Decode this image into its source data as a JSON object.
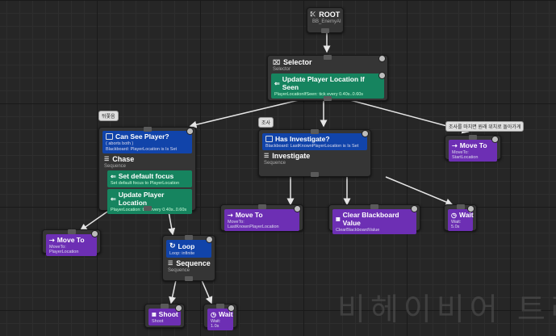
{
  "colors": {
    "background": "#262626",
    "composite": "#353535",
    "decorator": "#1144aa",
    "service": "#16845f",
    "task": "#6d2fb4",
    "wire": "#e6e6e6"
  },
  "root": {
    "title": "ROOT",
    "sub": "BB_EnemyAI",
    "icon": "root-icon"
  },
  "selector": {
    "title": "Selector",
    "sub": "Selector",
    "icon": "selector-icon",
    "service": {
      "title": "Update Player Location If Seen",
      "sub": "PlayerLocationIfSeen: tick every 0.40s..0.60s"
    }
  },
  "chase": {
    "comment": "뒤쫓음",
    "decorator": {
      "title": "Can See Player?",
      "line1": "( aborts both )",
      "line2": "Blackboard: PlayerLocation is Is Set"
    },
    "title": "Chase",
    "sub": "Sequence",
    "service1": {
      "title": "Set default focus",
      "sub": "Set default focus to PlayerLocation"
    },
    "service2": {
      "title": "Update Player Location",
      "sub": "PlayerLocation: tick every 0.40s..0.60s"
    }
  },
  "investigate": {
    "comment": "조사",
    "decorator": {
      "title": "Has Investigate?",
      "sub": "Blackboard: LastKnownPlayerLocation is Is Set"
    },
    "title": "Investigate",
    "sub": "Sequence"
  },
  "task_moveto_player": {
    "title": "Move To",
    "sub": "MoveTo: PlayerLocation"
  },
  "loop_node": {
    "decorator": {
      "title": "Loop",
      "sub": "Loop: infinite"
    },
    "title": "Sequence",
    "sub": "Sequence"
  },
  "task_shoot": {
    "title": "Shoot",
    "sub": "Shoot"
  },
  "task_wait_1": {
    "title": "Wait",
    "sub": "Wait: 1.0s"
  },
  "task_moveto_last": {
    "title": "Move To",
    "sub": "MoveTo: LastKnownPlayerLocation"
  },
  "task_clear_bb": {
    "title": "Clear Blackboard Value",
    "sub": "ClearBlackboardValue"
  },
  "task_wait_5": {
    "title": "Wait",
    "sub": "Wait: 5.0s"
  },
  "return": {
    "comment": "조사를 마치면 원래 위치로 돌아가게",
    "title": "Move To",
    "sub": "MoveTo: StartLocation"
  },
  "watermark": "비헤이비어 트리"
}
